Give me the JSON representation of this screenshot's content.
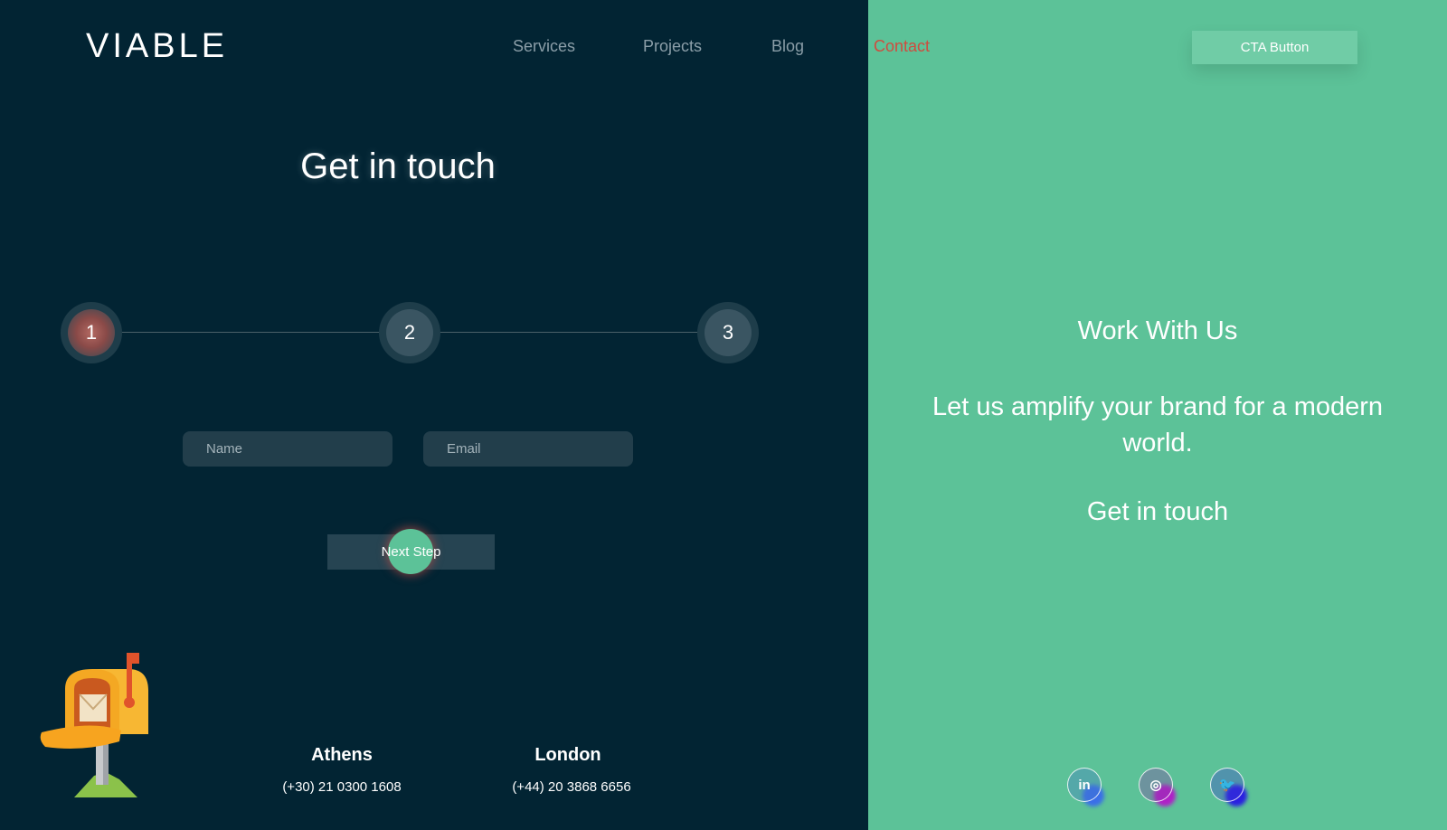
{
  "brand": {
    "logo": "VIABLE"
  },
  "nav": {
    "items": [
      {
        "label": "Services"
      },
      {
        "label": "Projects"
      },
      {
        "label": "Blog"
      },
      {
        "label": "Contact",
        "active": true
      }
    ],
    "cta_label": "CTA Button"
  },
  "form": {
    "title": "Get in touch",
    "steps": [
      "1",
      "2",
      "3"
    ],
    "active_step": 1,
    "name_placeholder": "Name",
    "email_placeholder": "Email",
    "next_label": "Next Step"
  },
  "offices": [
    {
      "city": "Athens",
      "phone": "(+30) 21 0300 1608"
    },
    {
      "city": "London",
      "phone": "(+44) 20 3868 6656"
    }
  ],
  "aside": {
    "title": "Work With Us",
    "tagline": "Let us amplify your brand for a modern world.",
    "cta": "Get in touch"
  },
  "social": [
    {
      "label": "in",
      "icon": "linkedin-icon"
    },
    {
      "label": "◎",
      "icon": "instagram-icon"
    },
    {
      "label": "🐦",
      "icon": "twitter-icon"
    }
  ],
  "colors": {
    "dark_bg": "#022433",
    "green": "#5cc298",
    "accent": "#cf4c3e",
    "cta_bg": "#70cca6"
  }
}
